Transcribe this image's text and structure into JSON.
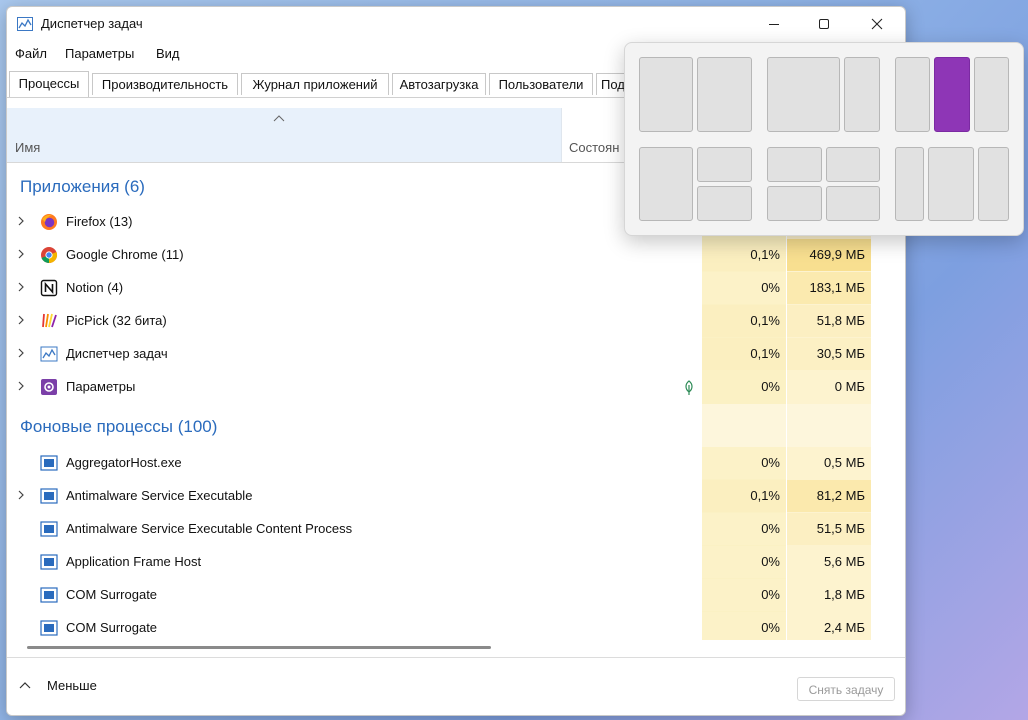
{
  "window": {
    "title": "Диспетчер задач",
    "minimize_icon": "minimize-icon",
    "maximize_icon": "maximize-icon",
    "close_icon": "close-icon"
  },
  "menu": [
    "Файл",
    "Параметры",
    "Вид"
  ],
  "tabs": [
    "Процессы",
    "Производительность",
    "Журнал приложений",
    "Автозагрузка",
    "Пользователи",
    "Под"
  ],
  "active_tab": "Процессы",
  "columns": {
    "name": "Имя",
    "status": "Состоян"
  },
  "groups": {
    "apps": "Приложения (6)",
    "background": "Фоновые процессы (100)"
  },
  "apps": [
    {
      "name": "Firefox (13)",
      "icon": "firefox-icon",
      "cpu": "",
      "mem": "",
      "expand": true
    },
    {
      "name": "Google Chrome (11)",
      "icon": "chrome-icon",
      "cpu": "0,1%",
      "mem": "469,9 МБ",
      "expand": true
    },
    {
      "name": "Notion (4)",
      "icon": "notion-icon",
      "cpu": "0%",
      "mem": "183,1 МБ",
      "expand": true
    },
    {
      "name": "PicPick (32 бита)",
      "icon": "picpick-icon",
      "cpu": "0,1%",
      "mem": "51,8 МБ",
      "expand": true
    },
    {
      "name": "Диспетчер задач",
      "icon": "task-manager-icon",
      "cpu": "0,1%",
      "mem": "30,5 МБ",
      "expand": true
    },
    {
      "name": "Параметры",
      "icon": "settings-app-icon",
      "cpu": "0%",
      "mem": "0 МБ",
      "expand": true,
      "suspended": true
    }
  ],
  "background": [
    {
      "name": "AggregatorHost.exe",
      "icon": "process-icon",
      "cpu": "0%",
      "mem": "0,5 МБ",
      "expand": false
    },
    {
      "name": "Antimalware Service Executable",
      "icon": "process-icon",
      "cpu": "0,1%",
      "mem": "81,2 МБ",
      "expand": true
    },
    {
      "name": "Antimalware Service Executable Content Process",
      "icon": "process-icon",
      "cpu": "0%",
      "mem": "51,5 МБ",
      "expand": false
    },
    {
      "name": "Application Frame Host",
      "icon": "process-icon",
      "cpu": "0%",
      "mem": "5,6 МБ",
      "expand": false
    },
    {
      "name": "COM Surrogate",
      "icon": "process-icon",
      "cpu": "0%",
      "mem": "1,8 МБ",
      "expand": false
    },
    {
      "name": "COM Surrogate",
      "icon": "process-icon",
      "cpu": "0%",
      "mem": "2,4 МБ",
      "expand": false
    }
  ],
  "footer": {
    "less": "Меньше",
    "end_task": "Снять задачу"
  },
  "snap_layouts": {
    "accent": "#8e36b6",
    "layouts": [
      "two-equal",
      "wide-left",
      "three-columns",
      "left-plus-two-stack",
      "four-quadrants",
      "three-columns-wide-middle"
    ],
    "selected": "three-columns middle zone"
  }
}
